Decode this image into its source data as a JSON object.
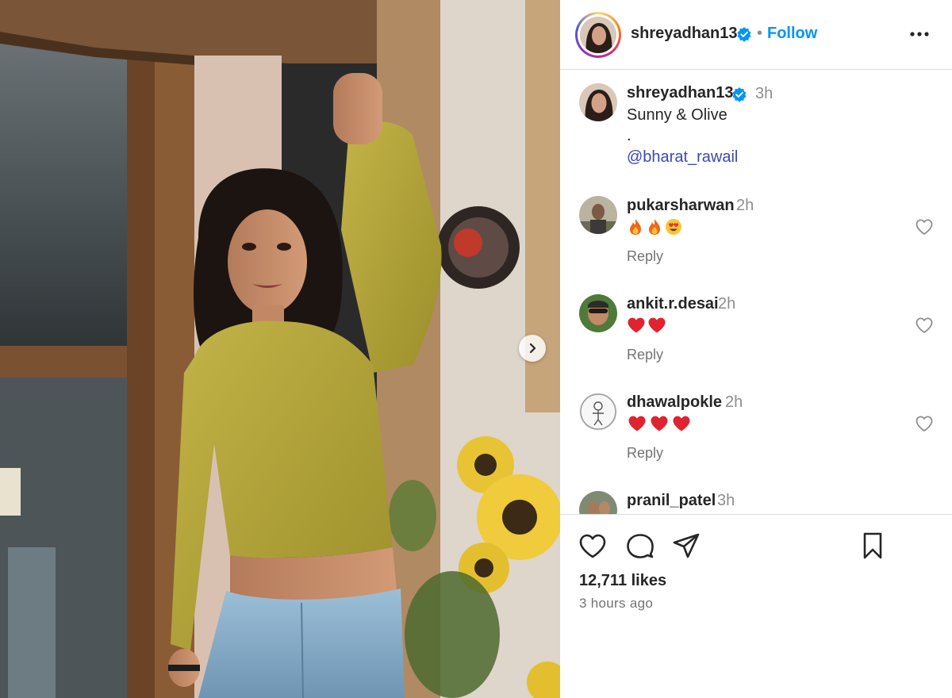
{
  "header": {
    "username": "shreyadhan13",
    "separator": "•",
    "follow_label": "Follow",
    "more_icon": "more-horizontal-icon"
  },
  "caption": {
    "username": "shreyadhan13",
    "time": "3h",
    "line1": "Sunny & Olive",
    "line2": ".",
    "mention": "@bharat_rawail"
  },
  "comments": [
    {
      "username": "pukarsharwan",
      "time": "2h",
      "emoji": [
        "fire",
        "fire",
        "heart-eyes"
      ],
      "reply_label": "Reply"
    },
    {
      "username": "ankit.r.desai",
      "time": "2h",
      "emoji": [
        "red-heart",
        "red-heart"
      ],
      "reply_label": "Reply"
    },
    {
      "username": "dhawalpokle",
      "time": "2h",
      "emoji": [
        "red-heart",
        "red-heart",
        "red-heart"
      ],
      "reply_label": "Reply"
    },
    {
      "username": "pranil_patel",
      "time": "3h"
    }
  ],
  "actions": {
    "like_icon": "heart-outline-icon",
    "comment_icon": "comment-bubble-icon",
    "share_icon": "paper-plane-icon",
    "save_icon": "bookmark-icon"
  },
  "likes_text": "12,711 likes",
  "posted_ago": "3 hours ago",
  "colors": {
    "follow_blue": "#0095f6",
    "verified_blue": "#0095f6",
    "mention_blue": "#3b49b5",
    "secondary_text": "#737373"
  }
}
